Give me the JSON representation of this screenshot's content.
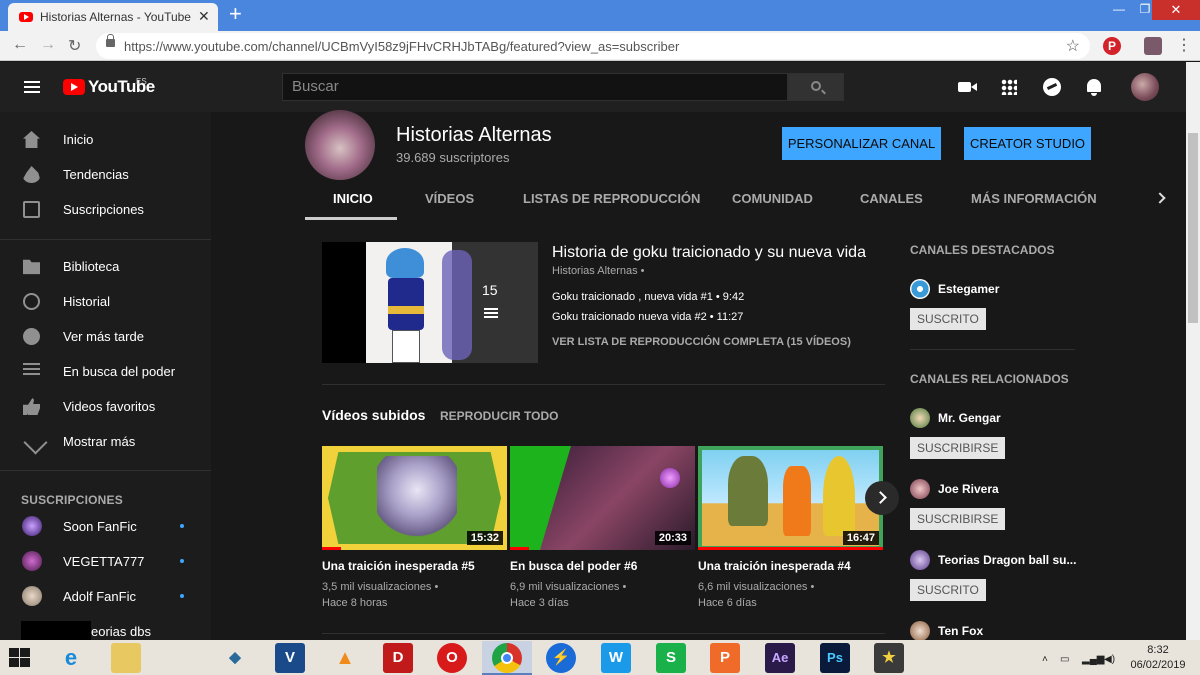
{
  "browser": {
    "tab_title": "Historias Alternas - YouTube",
    "url": "https://www.youtube.com/channel/UCBmVyI58z9jFHvCRHJbTABg/featured?view_as=subscriber"
  },
  "header": {
    "logo_text": "YouTube",
    "logo_region": "ES",
    "search_placeholder": "Buscar"
  },
  "sidebar": {
    "items": [
      {
        "label": "Inicio",
        "icon": "home-icon"
      },
      {
        "label": "Tendencias",
        "icon": "fire-icon"
      },
      {
        "label": "Suscripciones",
        "icon": "subscriptions-icon"
      },
      {
        "label": "Biblioteca",
        "icon": "library-icon"
      },
      {
        "label": "Historial",
        "icon": "history-icon"
      },
      {
        "label": "Ver más tarde",
        "icon": "clock-icon"
      },
      {
        "label": "En busca del poder",
        "icon": "playlist-icon"
      },
      {
        "label": "Videos favoritos",
        "icon": "thumbs-up-icon"
      },
      {
        "label": "Mostrar más",
        "icon": "chevron-down-icon"
      }
    ],
    "subscriptions_heading": "SUSCRIPCIONES",
    "subscriptions": [
      {
        "name": "Soon FanFic"
      },
      {
        "name": "VEGETTA777"
      },
      {
        "name": "Adolf FanFic"
      },
      {
        "name": "eorias dbs"
      }
    ]
  },
  "channel": {
    "name": "Historias Alternas",
    "subscribers": "39.689 suscriptores",
    "btn_personalize": "PERSONALIZAR CANAL",
    "btn_creator": "CREATOR STUDIO",
    "tabs": [
      "INICIO",
      "VÍDEOS",
      "LISTAS DE REPRODUCCIÓN",
      "COMUNIDAD",
      "CANALES",
      "MÁS INFORMACIÓN"
    ]
  },
  "featured_playlist": {
    "title": "Historia de goku traicionado y su nueva vida",
    "channel": "Historias Alternas •",
    "count": "15",
    "items": [
      "Goku traicionado , nueva vida #1 • 9:42",
      "Goku traicionado nueva vida #2 • 11:27"
    ],
    "view_all": "VER LISTA DE REPRODUCCIÓN COMPLETA (15 VÍDEOS)"
  },
  "uploads": {
    "title": "Vídeos subidos",
    "play_all": "REPRODUCIR TODO",
    "videos": [
      {
        "title": "Una traición inesperada #5",
        "duration": "15:32",
        "views": "3,5 mil visualizaciones •",
        "age": "Hace 8 horas",
        "progress": 0.1
      },
      {
        "title": "En busca del poder #6",
        "duration": "20:33",
        "views": "6,9 mil visualizaciones •",
        "age": "Hace 3 días",
        "progress": 0.1
      },
      {
        "title": "Una traición inesperada #4",
        "duration": "16:47",
        "views": "6,6 mil visualizaciones •",
        "age": "Hace 6 días",
        "progress": 1.0
      }
    ]
  },
  "right_column": {
    "featured_heading": "CANALES DESTACADOS",
    "featured": [
      {
        "name": "Estegamer",
        "button": "SUSCRITO"
      }
    ],
    "related_heading": "CANALES RELACIONADOS",
    "related": [
      {
        "name": "Mr. Gengar",
        "button": "SUSCRIBIRSE"
      },
      {
        "name": "Joe Rivera",
        "button": "SUSCRIBIRSE"
      },
      {
        "name": "Teorias Dragon ball su...",
        "button": "SUSCRITO"
      },
      {
        "name": "Ten Fox",
        "button": ""
      }
    ]
  },
  "taskbar": {
    "time": "8:32",
    "date": "06/02/2019",
    "apps": [
      "ie-icon",
      "file-explorer-icon",
      "vegas-icon",
      "vlc-icon",
      "d-app-icon",
      "opera-icon",
      "chrome-icon",
      "messenger-icon",
      "wps-writer-icon",
      "wps-spreadsheet-icon",
      "wps-presentation-icon",
      "after-effects-icon",
      "photoshop-icon",
      "app-icon"
    ]
  },
  "colors": {
    "accent_blue": "#3ea6ff",
    "yt_red": "#ff0000",
    "background": "#181818"
  }
}
